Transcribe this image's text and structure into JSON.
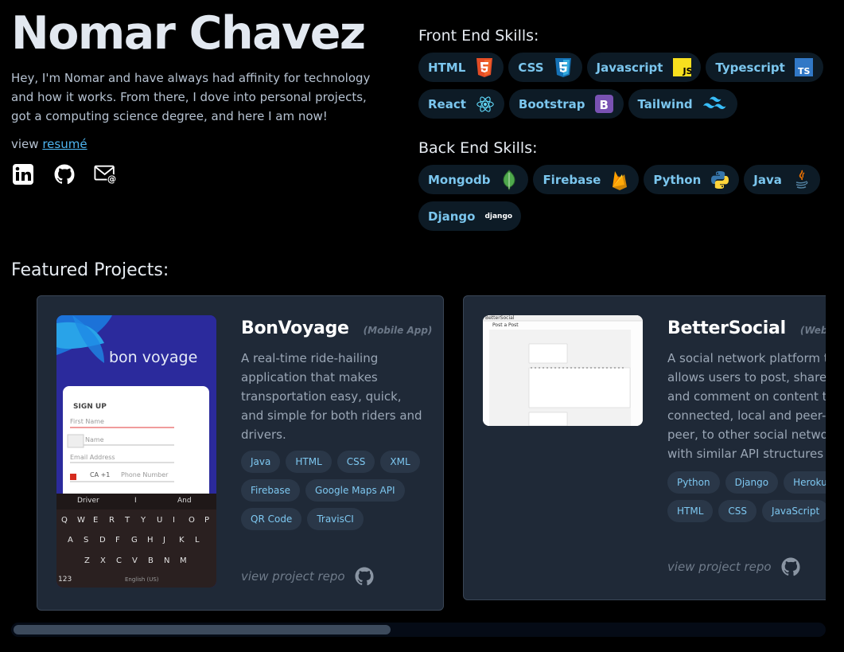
{
  "header": {
    "name": "Nomar Chavez",
    "bio": "Hey, I'm Nomar and have always had affinity for technology and how it works. From there, I dove into personal projects, got a computing science degree, and here I am now!",
    "resume_prefix": "view",
    "resume_link": "resumé",
    "socials": [
      "linkedin-icon",
      "github-icon",
      "email-icon"
    ]
  },
  "skills": {
    "front_title": "Front End Skills:",
    "front": [
      {
        "label": "HTML",
        "icon": "html5-icon"
      },
      {
        "label": "CSS",
        "icon": "css3-icon"
      },
      {
        "label": "Javascript",
        "icon": "javascript-icon"
      },
      {
        "label": "Typescript",
        "icon": "typescript-icon"
      },
      {
        "label": "React",
        "icon": "react-icon"
      },
      {
        "label": "Bootstrap",
        "icon": "bootstrap-icon"
      },
      {
        "label": "Tailwind",
        "icon": "tailwind-icon"
      }
    ],
    "back_title": "Back End Skills:",
    "back": [
      {
        "label": "Mongodb",
        "icon": "mongodb-icon"
      },
      {
        "label": "Firebase",
        "icon": "firebase-icon"
      },
      {
        "label": "Python",
        "icon": "python-icon"
      },
      {
        "label": "Java",
        "icon": "java-icon"
      },
      {
        "label": "Django",
        "icon": "django-icon",
        "icon_text": "django"
      }
    ]
  },
  "featured": {
    "title": "Featured Projects:",
    "projects": [
      {
        "title": "BonVoyage",
        "type": "(Mobile App)",
        "description": "A real-time ride-hailing application that makes transportation easy, quick, and simple for both riders and drivers.",
        "tags": [
          "Java",
          "HTML",
          "CSS",
          "XML",
          "Firebase",
          "Google Maps API",
          "QR Code",
          "TravisCI"
        ],
        "repo_label": "view project repo",
        "screenshot": {
          "logo": "bon voyage",
          "form_title": "SIGN UP",
          "fields": [
            "First Name",
            "Name",
            "Email Address"
          ],
          "phone_prefix": "CA +1",
          "phone_placeholder": "Phone Number",
          "suggestions": [
            "Driver",
            "I",
            "And"
          ],
          "rows": [
            [
              "Q",
              "W",
              "E",
              "R",
              "T",
              "Y",
              "U",
              "I",
              "O",
              "P"
            ],
            [
              "A",
              "S",
              "D",
              "F",
              "G",
              "H",
              "J",
              "K",
              "L"
            ],
            [
              "Z",
              "X",
              "C",
              "V",
              "B",
              "N",
              "M"
            ]
          ],
          "bottom_left": "123",
          "space_label": "English (US)"
        }
      },
      {
        "title": "BetterSocial",
        "type": "(Web App)",
        "description": "A social network platform that allows users to post, share, like and comment on content that's connected, local and peer-to-peer, to other social networks with similar API structures",
        "tags": [
          "Python",
          "Django",
          "Heroku",
          "HTML",
          "CSS",
          "JavaScript"
        ],
        "repo_label": "view project repo",
        "screenshot": {
          "brand": "BetterSocial",
          "heading": "Post a Post"
        }
      }
    ]
  },
  "colors": {
    "background": "#000000",
    "pill_bg": "#0d1b26",
    "pill_text": "#7bc6ee",
    "card_bg": "#1f2937",
    "link": "#4fb5f0"
  }
}
